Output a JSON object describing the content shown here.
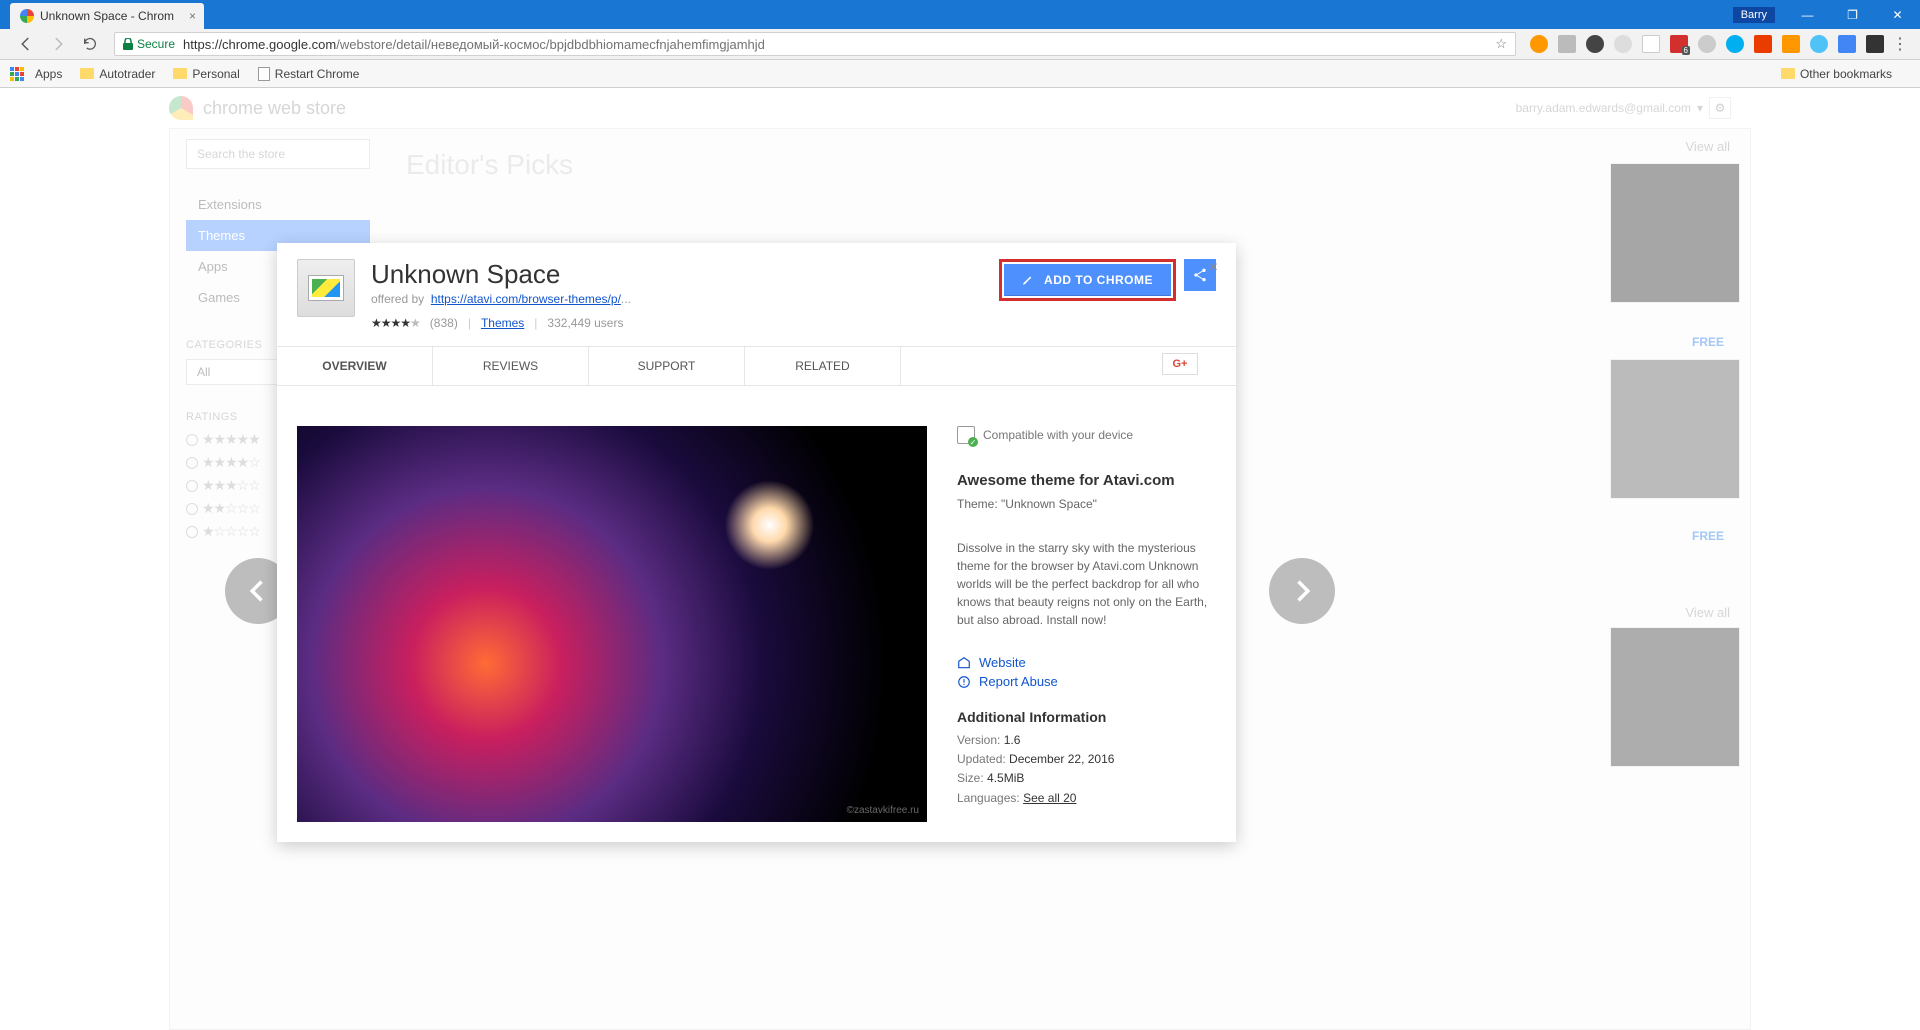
{
  "window": {
    "tab_title": "Unknown Space - Chrom",
    "user": "Barry"
  },
  "address": {
    "secure": "Secure",
    "host": "https://chrome.google.com",
    "path": "/webstore/detail/неведомый-космос/bpjdbdbhiomamecfnjahemfimgjamhjd",
    "badge": "6"
  },
  "bookmarks": {
    "apps": "Apps",
    "items": [
      "Autotrader",
      "Personal",
      "Restart Chrome"
    ],
    "other": "Other bookmarks"
  },
  "store": {
    "title": "chrome web store",
    "user_email": "barry.adam.edwards@gmail.com",
    "search_placeholder": "Search the store",
    "menu": {
      "extensions": "Extensions",
      "themes": "Themes",
      "apps": "Apps",
      "games": "Games"
    },
    "categories_label": "CATEGORIES",
    "categories_value": "All",
    "ratings_label": "RATINGS",
    "editor_picks": "Editor's Picks",
    "view_all": "View all",
    "free": "FREE"
  },
  "ext": {
    "name": "Unknown Space",
    "offered_by": "offered by",
    "offered_link": "https://atavi.com/browser-themes/p/",
    "rating_count": "(838)",
    "themes": "Themes",
    "users": "332,449 users",
    "add_to_chrome": "ADD TO CHROME",
    "gplus": "G+",
    "tabs": {
      "overview": "OVERVIEW",
      "reviews": "REVIEWS",
      "support": "SUPPORT",
      "related": "RELATED"
    },
    "compatible": "Compatible with your device",
    "heading": "Awesome theme for Atavi.com",
    "theme_line": "Theme: \"Unknown Space\"",
    "description": "Dissolve in the starry sky with the mysterious theme for the browser by Atavi.com Unknown worlds will be the perfect backdrop for all who knows that beauty reigns not only on the Earth, but also abroad. Install now!",
    "website": "Website",
    "report": "Report Abuse",
    "additional": "Additional Information",
    "version_k": "Version:",
    "version_v": "1.6",
    "updated_k": "Updated:",
    "updated_v": "December 22, 2016",
    "size_k": "Size:",
    "size_v": "4.5MiB",
    "lang_k": "Languages:",
    "lang_v": "See all 20",
    "watermark": "©zastavkifree.ru"
  }
}
